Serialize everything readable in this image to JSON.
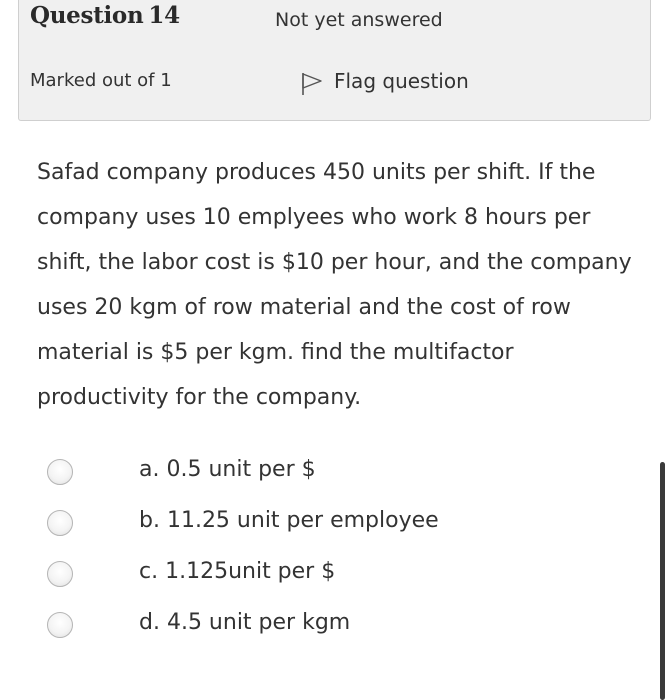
{
  "info": {
    "question_label": "Question",
    "question_number": "14",
    "status": "Not yet answered",
    "marks": "Marked out of 1",
    "flag_label": "Flag question"
  },
  "question": {
    "lines": [
      "Safad company produces 450 units per shift. If the",
      "company uses 10 emplyees who work 8 hours per",
      "shift, the labor cost is $10 per hour, and the company",
      "uses 20 kgm of row material and the cost of row",
      "material is $5 per kgm. find the multifactor",
      "productivity for the company."
    ]
  },
  "answers": [
    {
      "label": "a. 0.5 unit per $"
    },
    {
      "label": "b. 11.25 unit per employee"
    },
    {
      "label": "c. 1.125unit per $"
    },
    {
      "label": "d. 4.5 unit per kgm"
    }
  ],
  "icons": {
    "flag": "flag-icon",
    "radio": "radio-icon"
  }
}
